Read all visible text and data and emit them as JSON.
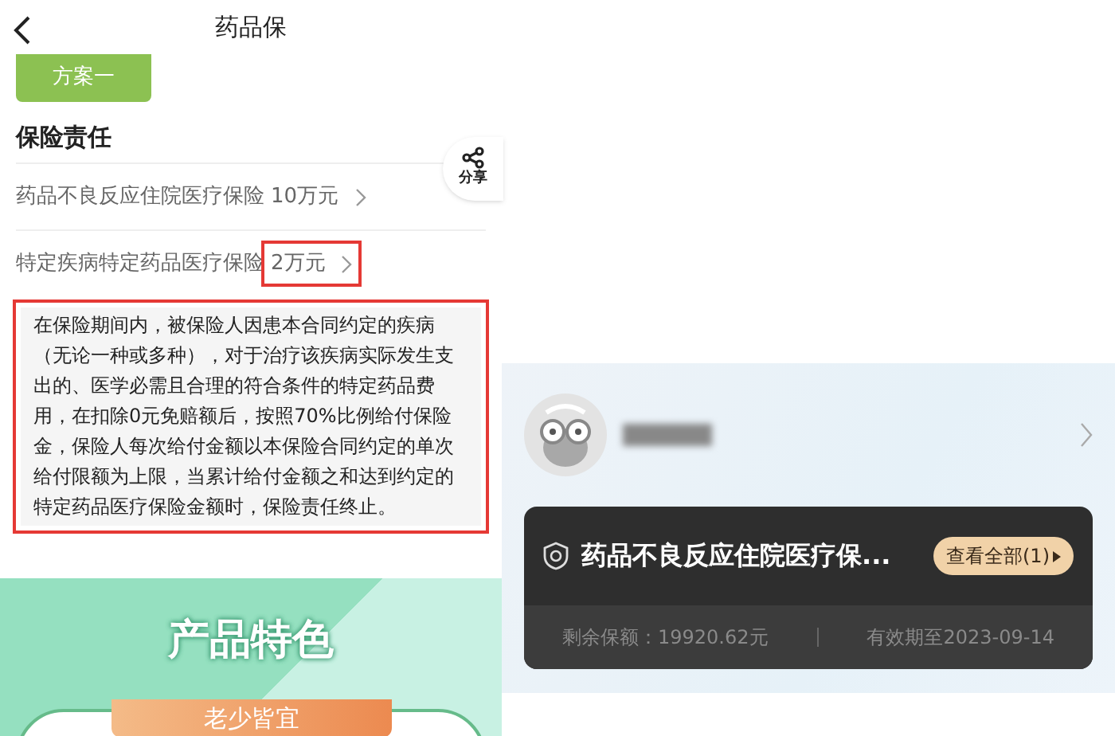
{
  "left_screen": {
    "title": "药品保",
    "plan_button": "方案一",
    "section_title": "保险责任",
    "share": {
      "label": "分享"
    },
    "coverage_rows": [
      {
        "name": "药品不良反应住院医疗保险",
        "amount": "10万元",
        "highlighted": false
      },
      {
        "name": "特定疾病特定药品医疗保险",
        "amount": "2万元",
        "highlighted": true
      }
    ],
    "description": "在保险期间内，被保险人因患本合同约定的疾病（无论一种或多种），对于治疗该疾病实际发生支出的、医学必需且合理的符合条件的特定药品费用，在扣除0元免赔额后，按照70%比例给付保险金，保险人每次给付金额以本保险合同约定的单次给付限额为上限，当累计给付金额之和达到约定的特定药品医疗保险金额时，保险责任终止。",
    "feature_banner": {
      "title": "产品特色",
      "tag": "老少皆宜"
    }
  },
  "right_screen": {
    "policy_card": {
      "title": "药品不良反应住院医疗保...",
      "view_all": "查看全部(1)",
      "remaining": "剩余保额：19920.62元",
      "valid_until": "有效期至2023-09-14"
    }
  }
}
